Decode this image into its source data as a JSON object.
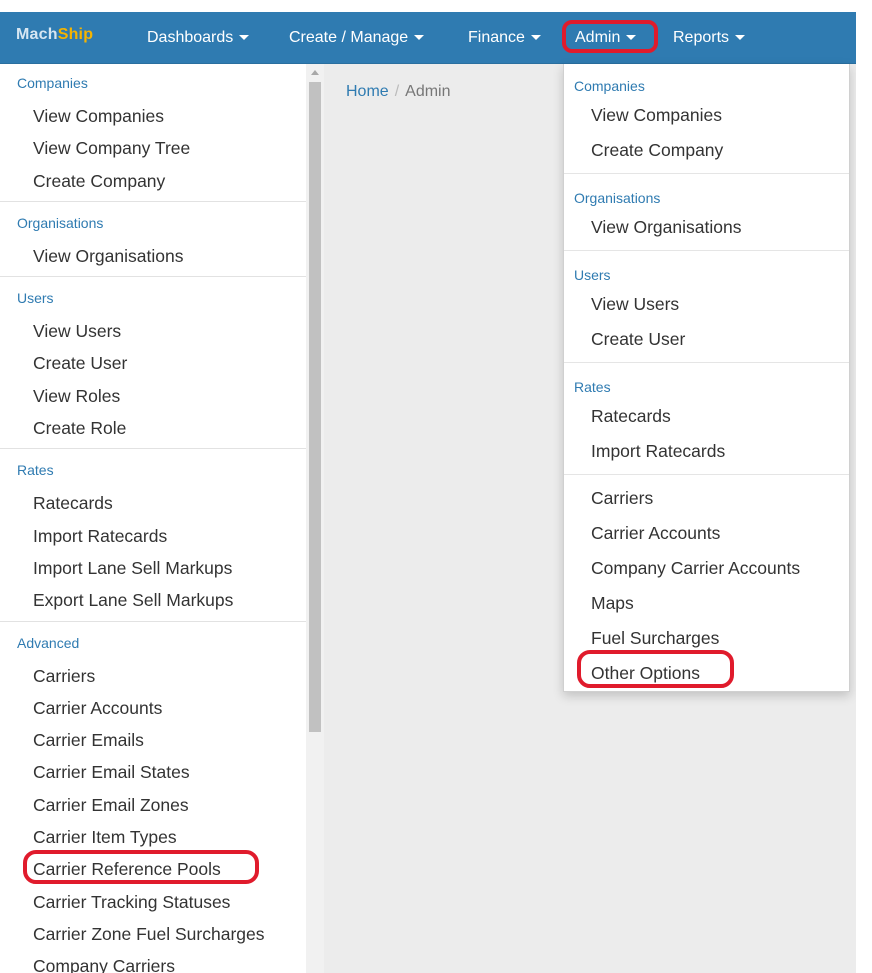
{
  "brand": {
    "part1": "Mach",
    "part2": "Ship"
  },
  "nav": {
    "dashboards": "Dashboards",
    "create_manage": "Create / Manage",
    "finance": "Finance",
    "admin": "Admin",
    "reports": "Reports"
  },
  "breadcrumb": {
    "home": "Home",
    "separator": "/",
    "current": "Admin"
  },
  "sidebar": {
    "companies": {
      "header": "Companies",
      "items": [
        "View Companies",
        "View Company Tree",
        "Create Company"
      ]
    },
    "organisations": {
      "header": "Organisations",
      "items": [
        "View Organisations"
      ]
    },
    "users": {
      "header": "Users",
      "items": [
        "View Users",
        "Create User",
        "View Roles",
        "Create Role"
      ]
    },
    "rates": {
      "header": "Rates",
      "items": [
        "Ratecards",
        "Import Ratecards",
        "Import Lane Sell Markups",
        "Export Lane Sell Markups"
      ]
    },
    "advanced": {
      "header": "Advanced",
      "items": [
        "Carriers",
        "Carrier Accounts",
        "Carrier Emails",
        "Carrier Email States",
        "Carrier Email Zones",
        "Carrier Item Types",
        "Carrier Reference Pools",
        "Carrier Tracking Statuses",
        "Carrier Zone Fuel Surcharges",
        "Company Carriers"
      ]
    }
  },
  "admin_menu": {
    "companies": {
      "header": "Companies",
      "items": [
        "View Companies",
        "Create Company"
      ]
    },
    "organisations": {
      "header": "Organisations",
      "items": [
        "View Organisations"
      ]
    },
    "users": {
      "header": "Users",
      "items": [
        "View Users",
        "Create User"
      ]
    },
    "rates": {
      "header": "Rates",
      "items": [
        "Ratecards",
        "Import Ratecards"
      ]
    },
    "other": {
      "items": [
        "Carriers",
        "Carrier Accounts",
        "Company Carrier Accounts",
        "Maps",
        "Fuel Surcharges",
        "Other Options"
      ]
    }
  },
  "colors": {
    "navbar": "#2f7bb1",
    "accent": "#2f7bb1",
    "brand_highlight": "#f5b400",
    "annotation": "#e01b2c"
  }
}
